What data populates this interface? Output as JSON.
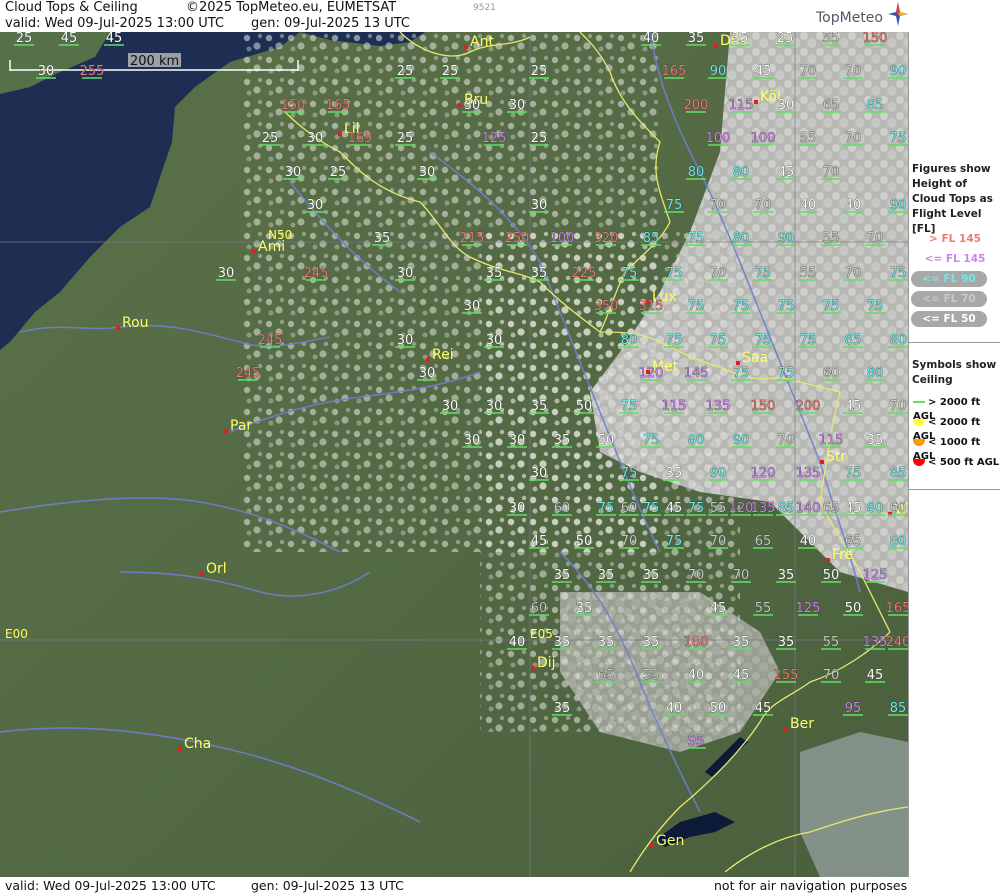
{
  "header": {
    "title": "Cloud Tops & Ceiling",
    "copyright": "©2025 TopMeteo.eu, EUMETSAT",
    "code": "9521",
    "valid": "valid:  Wed  09-Jul-2025  13:00 UTC",
    "gen": "gen: 09-Jul-2025 13 UTC",
    "logo": "TopMeteo"
  },
  "footer": {
    "valid": "valid:  Wed  09-Jul-2025  13:00 UTC",
    "gen": "gen: 09-Jul-2025 13 UTC",
    "disclaimer": "not for air navigation purposes"
  },
  "scale_bar": "200 km",
  "grid_labels": [
    "N50",
    "E00",
    "E05"
  ],
  "colors": {
    "gt145": "#f07878",
    "le145": "#d080f0",
    "le90": "#70e8e8",
    "le70": "#c8c8c8",
    "le50": "#ffffff",
    "city": "#ffff66",
    "gt2000": "#60e060",
    "lt2000": "#ffff33",
    "lt1000": "#ff9900",
    "lt500": "#ff0000"
  },
  "legend": {
    "fl_title": "Figures show Height of Cloud Tops as Flight Level  [FL]",
    "fl_items": [
      {
        "label": "> FL 145",
        "key": "gt145"
      },
      {
        "label": "<= FL 145",
        "key": "le145"
      },
      {
        "label": "<= FL 90",
        "key": "le90"
      },
      {
        "label": "<= FL 70",
        "key": "le70"
      },
      {
        "label": "<= FL 50",
        "key": "le50"
      }
    ],
    "sym_title": "Symbols show Ceiling",
    "sym_items": [
      {
        "label": "> 2000 ft AGL",
        "key": "gt2000"
      },
      {
        "label": "< 2000 ft AGL",
        "key": "lt2000"
      },
      {
        "label": "< 1000 ft AGL",
        "key": "lt1000"
      },
      {
        "label": "< 500 ft AGL",
        "key": "lt500"
      }
    ]
  },
  "cities": [
    "Ant",
    "Düs",
    "Bru",
    "Köl",
    "Lil",
    "Ami",
    "Lux",
    "Rou",
    "Rei",
    "Saa",
    "Met",
    "Par",
    "Str",
    "Fre",
    "Orl",
    "Dij",
    "Ber",
    "Cha",
    "Gen",
    "W"
  ],
  "fl_values": [
    "25",
    "45",
    "45",
    "30",
    "255",
    "25",
    "25",
    "25",
    "150",
    "165",
    "30",
    "30",
    "25",
    "30",
    "165",
    "25",
    "125",
    "25",
    "30",
    "25",
    "30",
    "30",
    "30",
    "35",
    "215",
    "250",
    "100",
    "320",
    "30",
    "245",
    "30",
    "35",
    "35",
    "225",
    "30",
    "350",
    "315",
    "245",
    "30",
    "30",
    "30",
    "245",
    "30",
    "30",
    "35",
    "50",
    "30",
    "30",
    "35",
    "50",
    "30",
    "30",
    "45",
    "50",
    "35",
    "35",
    "35",
    "60",
    "35",
    "40",
    "35",
    "35",
    "35",
    "35",
    "40",
    "35",
    "35",
    "25",
    "55",
    "150",
    "165",
    "90",
    "45",
    "70",
    "70",
    "90",
    "200",
    "115",
    "30",
    "65",
    "85",
    "100",
    "100",
    "55",
    "70",
    "75",
    "80",
    "80",
    "45",
    "70",
    "75",
    "70",
    "70",
    "40",
    "40",
    "90",
    "85",
    "75",
    "80",
    "90",
    "55",
    "70",
    "75",
    "75",
    "70",
    "75",
    "55",
    "70",
    "75",
    "75",
    "75",
    "75",
    "75",
    "75",
    "80",
    "75",
    "75",
    "75",
    "75",
    "85",
    "80",
    "120",
    "145",
    "75",
    "75",
    "60",
    "80",
    "75",
    "115",
    "135",
    "150",
    "200",
    "45",
    "70",
    "75",
    "80",
    "90",
    "70",
    "115",
    "35",
    "75",
    "35",
    "90",
    "120",
    "135",
    "75",
    "85",
    "60",
    "45",
    "55",
    "135",
    "140",
    "45",
    "60",
    "60",
    "75",
    "75",
    "75",
    "120",
    "85",
    "65",
    "80",
    "70",
    "75",
    "70",
    "65",
    "40",
    "65",
    "80",
    "70",
    "70",
    "35",
    "50",
    "125",
    "45",
    "55",
    "125",
    "50",
    "165",
    "240",
    "180",
    "35",
    "35",
    "55",
    "135",
    "65",
    "55",
    "40",
    "45",
    "155",
    "70",
    "45",
    "40",
    "50",
    "45",
    "95",
    "85",
    "95"
  ]
}
